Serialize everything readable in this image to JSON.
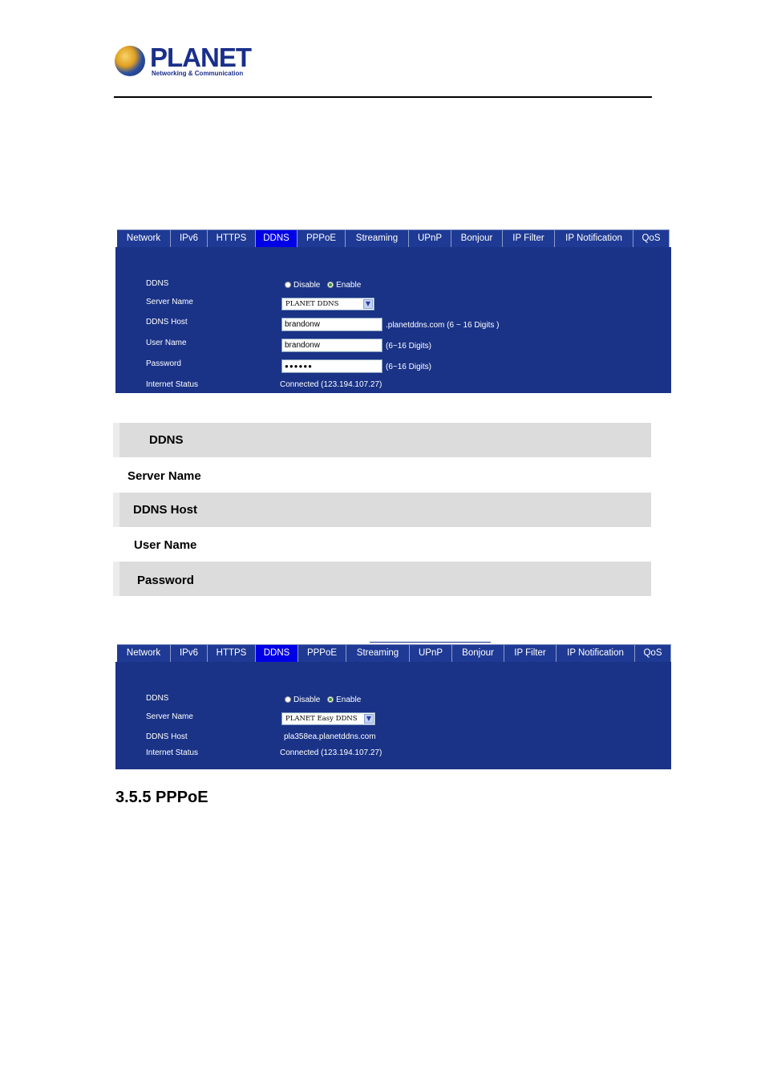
{
  "header": {
    "logo_word": "PLANET",
    "logo_tagline": "Networking & Communication"
  },
  "tabs": [
    "Network",
    "IPv6",
    "HTTPS",
    "DDNS",
    "PPPoE",
    "Streaming",
    "UPnP",
    "Bonjour",
    "IP Filter",
    "IP Notification",
    "QoS"
  ],
  "active_tab": "DDNS",
  "panel1": {
    "ddns_label": "DDNS",
    "disable_label": "Disable",
    "enable_label": "Enable",
    "ddns_selected": "Enable",
    "server_name_label": "Server Name",
    "server_name_value": "PLANET DDNS",
    "ddns_host_label": "DDNS Host",
    "ddns_host_value": "brandonw",
    "ddns_host_hint": ".planetddns.com (6 ~ 16 Digits )",
    "user_name_label": "User Name",
    "user_name_value": "brandonw",
    "user_name_hint": "(6~16 Digits)",
    "password_label": "Password",
    "password_value": "●●●●●●",
    "password_hint": "(6~16 Digits)",
    "status_label": "Internet Status",
    "status_value": "Connected (123.194.107.27)"
  },
  "description_rows": [
    "DDNS",
    "Server Name",
    "DDNS Host",
    "User Name",
    "Password"
  ],
  "panel2": {
    "ddns_label": "DDNS",
    "disable_label": "Disable",
    "enable_label": "Enable",
    "ddns_selected": "Enable",
    "server_name_label": "Server Name",
    "server_name_value": "PLANET Easy DDNS",
    "ddns_host_label": "DDNS Host",
    "ddns_host_value": "pla358ea.planetddns.com",
    "status_label": "Internet Status",
    "status_value": "Connected (123.194.107.27)"
  },
  "section_title": "3.5.5 PPPoE",
  "colors": {
    "panel_bg": "#1a3387",
    "tab_bg": "#1f3a94",
    "tab_active_bg": "#0000e6",
    "row_shade": "#dcdcdc"
  }
}
